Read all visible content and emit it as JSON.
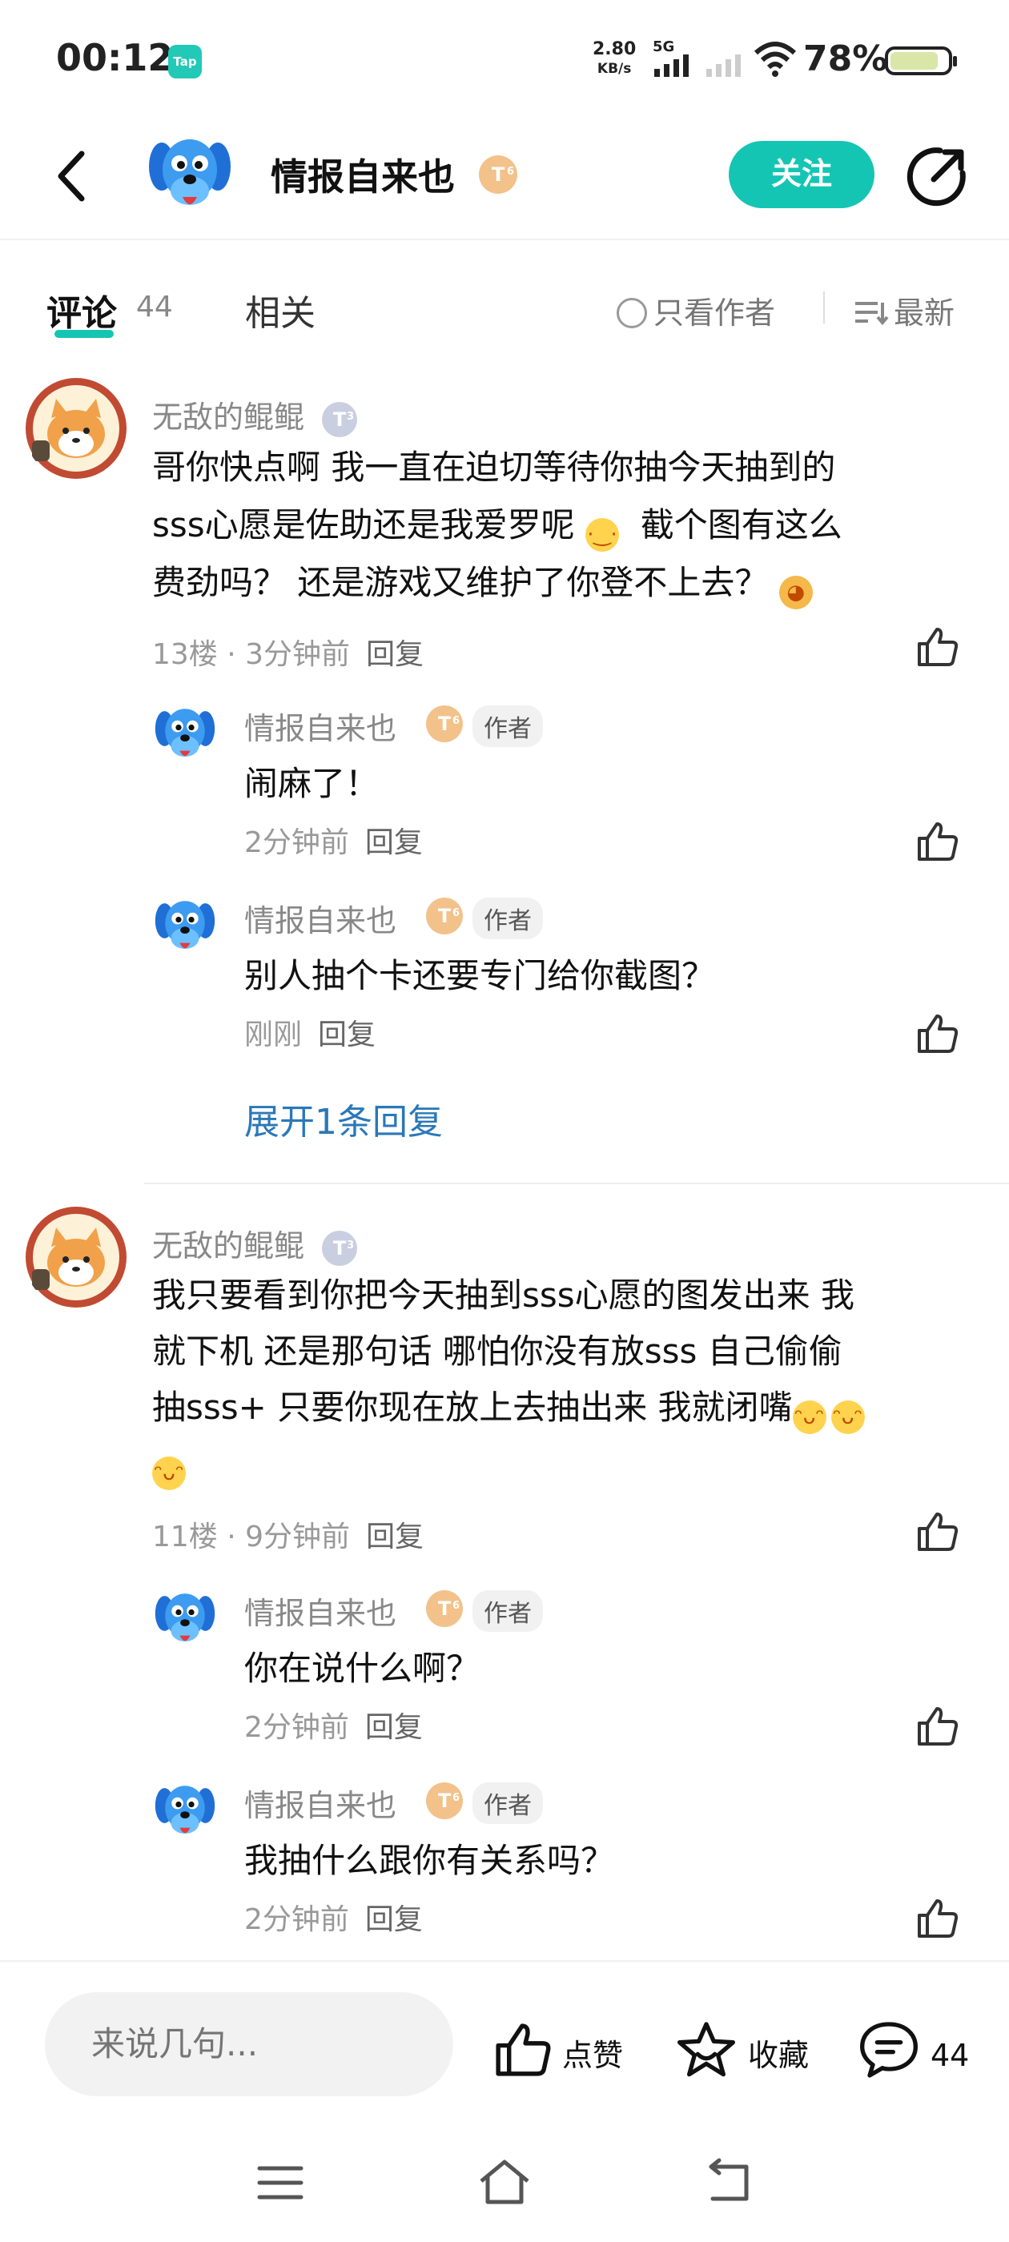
{
  "status_bar": {
    "time": "00:12",
    "app_badge": "Tap",
    "net_speed_value": "2.80",
    "net_speed_unit": "KB/s",
    "network": "5G",
    "battery_percent": "78%",
    "battery_level": 0.78
  },
  "header": {
    "title": "情报自来也",
    "level": "T",
    "level_sub": "6",
    "follow_label": "关注",
    "icons": [
      "back-arrow-icon",
      "share-icon"
    ]
  },
  "tabs": {
    "comments_label": "评论",
    "comments_count": "44",
    "related_label": "相关",
    "only_author_label": "只看作者",
    "sort_label": "最新"
  },
  "comments": [
    {
      "user": "无敌的鲲鲲",
      "level": "T",
      "level_sub": "3",
      "text_line1": "哥你快点啊 我一直在迫切等待你抽今天抽到的",
      "text_line2a": "sss心愿是佐助还是我爱罗呢",
      "text_line2b": "截个图有这么",
      "text_line3": "费劲吗？ 还是游戏又维护了你登不上去？",
      "floor": "13楼",
      "time": "3分钟前",
      "reply_label": "回复",
      "replies": [
        {
          "user": "情报自来也",
          "level": "T",
          "level_sub": "6",
          "tag": "作者",
          "text": "闹麻了！",
          "time": "2分钟前",
          "reply_label": "回复"
        },
        {
          "user": "情报自来也",
          "level": "T",
          "level_sub": "6",
          "tag": "作者",
          "text": "别人抽个卡还要专门给你截图？",
          "time": "刚刚",
          "reply_label": "回复"
        }
      ],
      "expand_label": "展开1条回复"
    },
    {
      "user": "无敌的鲲鲲",
      "level": "T",
      "level_sub": "3",
      "text_line1": "我只要看到你把今天抽到sss心愿的图发出来 我",
      "text_line2": "就下机  还是那句话 哪怕你没有放sss 自己偷偷",
      "text_line3": "抽sss+ 只要你现在放上去抽出来 我就闭嘴",
      "floor": "11楼",
      "time": "9分钟前",
      "reply_label": "回复",
      "replies": [
        {
          "user": "情报自来也",
          "level": "T",
          "level_sub": "6",
          "tag": "作者",
          "text": "你在说什么啊？",
          "time": "2分钟前",
          "reply_label": "回复"
        },
        {
          "user": "情报自来也",
          "level": "T",
          "level_sub": "6",
          "tag": "作者",
          "text": "我抽什么跟你有关系吗？",
          "time": "2分钟前",
          "reply_label": "回复"
        }
      ]
    }
  ],
  "bottom_bar": {
    "input_placeholder": "来说几句...",
    "like_label": "点赞",
    "favorite_label": "收藏",
    "comment_count": "44"
  },
  "colors": {
    "accent": "#15c5b4",
    "link": "#2a78b8",
    "level_gold": "#f2c28a",
    "level_silver": "#c9cfe0"
  }
}
